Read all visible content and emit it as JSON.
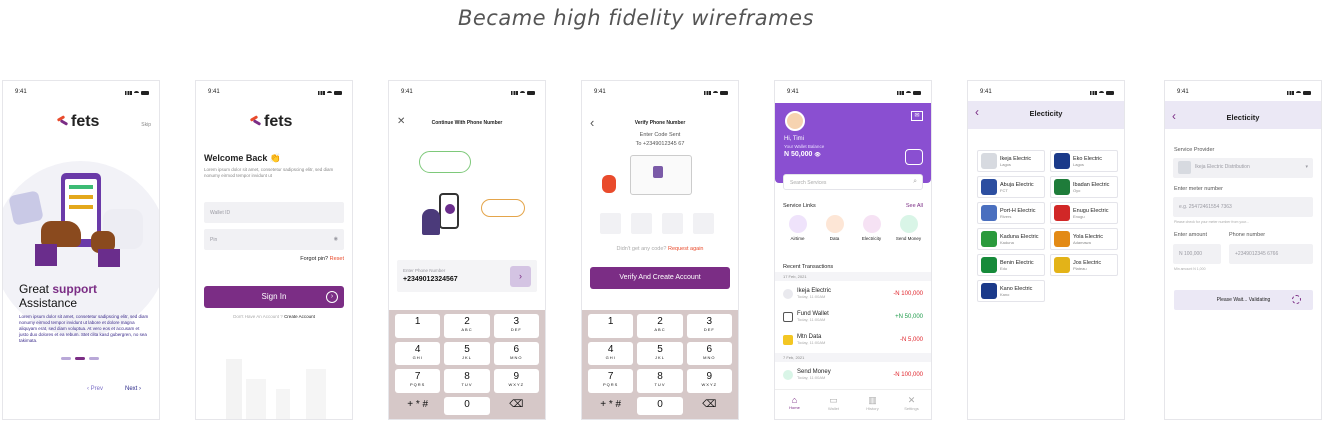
{
  "headline": "Became high fidelity wireframes",
  "status_time": "9:41",
  "screen1": {
    "brand": "fets",
    "skip": "Skip",
    "title_plain": "Great ",
    "title_bold": "support",
    "title_line2": "Assistance",
    "body": "Lorem ipsum dolor sit amet, consetetur sadipscing elitr, sed diam nonumy eirmod tempor invidunt ut labore et dolore magna aliquyam erat, sed diam voluptua. At vero eos et accusam et justo duo dolores et ea rebum. Stet clita kasd gubergren, no sea takimata.",
    "prev": "Prev",
    "next": "Next"
  },
  "screen2": {
    "brand": "fets",
    "welcome": "Welcome Back 👏",
    "subtitle": "Lorem ipsum dolor sit amet, consetetur sadipscing elitr, sed diam nonumy eirmod tempor invidunt ut",
    "wallet_placeholder": "Wallet ID",
    "pin_placeholder": "Pin",
    "forgot": "Forgot pin?",
    "reset": "Reset",
    "signin": "Sign In",
    "no_account": "Don't Have An Account ?",
    "create": "Create Account"
  },
  "screen3": {
    "title": "Continue With Phone Number",
    "phone_label": "Enter Phone Number",
    "phone_value": "+2349012324567"
  },
  "screen4": {
    "title": "Verify Phone Number",
    "code_sent": "Enter Code Sent",
    "to": "To +2349012345 67",
    "resend_q": "Didn't get any code?",
    "resend": "Request again",
    "button": "Verify And Create Account"
  },
  "keypad": [
    {
      "num": "1",
      "letters": ""
    },
    {
      "num": "2",
      "letters": "ABC"
    },
    {
      "num": "3",
      "letters": "DEF"
    },
    {
      "num": "4",
      "letters": "GHI"
    },
    {
      "num": "5",
      "letters": "JKL"
    },
    {
      "num": "6",
      "letters": "MNO"
    },
    {
      "num": "7",
      "letters": "PQRS"
    },
    {
      "num": "8",
      "letters": "TUV"
    },
    {
      "num": "9",
      "letters": "WXYZ"
    },
    {
      "num": "+ * #",
      "letters": ""
    },
    {
      "num": "0",
      "letters": ""
    },
    {
      "num": "⌫",
      "letters": ""
    }
  ],
  "screen5": {
    "greeting": "Hi, Timi",
    "balance_label": "Your Wallet Balance",
    "balance": "N 50,000",
    "search_placeholder": "Search Services",
    "services_title": "Service Links",
    "see_all": "See All",
    "services": [
      "Airtime",
      "Data",
      "Electricity",
      "Send Money"
    ],
    "recent_title": "Recent Transactions",
    "date1": "17 Feb, 2021",
    "date2": "7 Feb, 2021",
    "transactions": [
      {
        "name": "Ikeja Electric",
        "meta": "Today, 11:00AM",
        "amount": "-N 100,000",
        "color": "#e0242b"
      },
      {
        "name": "Fund Wallet",
        "meta": "Today, 11:00AM",
        "amount": "+N 50,000",
        "color": "#1e9b4a"
      },
      {
        "name": "Mtn Data",
        "meta": "Today, 11:00AM",
        "amount": "-N 5,000",
        "color": "#e0242b"
      },
      {
        "name": "Send Money",
        "meta": "Today, 11:00AM",
        "amount": "-N 100,000",
        "color": "#e0242b"
      }
    ],
    "nav": [
      "Home",
      "Wallet",
      "History",
      "Settings"
    ]
  },
  "screen6": {
    "title": "Electicity",
    "providers": [
      {
        "name": "Ikeja Electric",
        "city": "Lagos",
        "color": "#d7dae0"
      },
      {
        "name": "Eko Electric",
        "city": "Lagos",
        "color": "#1b3a8a"
      },
      {
        "name": "Abuja Electric",
        "city": "FCT",
        "color": "#2c4ea0"
      },
      {
        "name": "Ibadan Electric",
        "city": "Oyo",
        "color": "#1e7c3a"
      },
      {
        "name": "Port-H Electric",
        "city": "Rivers",
        "color": "#4a6fbf"
      },
      {
        "name": "Enugu Electric",
        "city": "Enugu",
        "color": "#d12727"
      },
      {
        "name": "Kaduna Electric",
        "city": "Kaduna",
        "color": "#2a9a3c"
      },
      {
        "name": "Yola Electric",
        "city": "Adamawa",
        "color": "#e38a15"
      },
      {
        "name": "Benin Electric",
        "city": "Edo",
        "color": "#168a3a"
      },
      {
        "name": "Jos Electric",
        "city": "Plateau",
        "color": "#e3b318"
      },
      {
        "name": "Kano Electric",
        "city": "Kano",
        "color": "#1b3a8a"
      }
    ]
  },
  "screen7": {
    "title": "Electicity",
    "provider_label": "Service Provider",
    "provider_value": "Ikeja Electric Distribution",
    "meter_label": "Enter meter number",
    "meter_value": "e.g. 25472461554 7363",
    "meter_hint": "Please check for your meter number from your...",
    "amount_label": "Enter amount",
    "amount_value": "N 100,000",
    "amount_hint": "Min amount N 1,000",
    "phone_label": "Phone number",
    "phone_value": "+2349012345 6766",
    "validating": "Please Wait... Validating"
  },
  "colors": {
    "brand_purple": "#7b2d85",
    "violet_header": "#8a4fd1",
    "keypad_bg": "#d6c8c8"
  }
}
